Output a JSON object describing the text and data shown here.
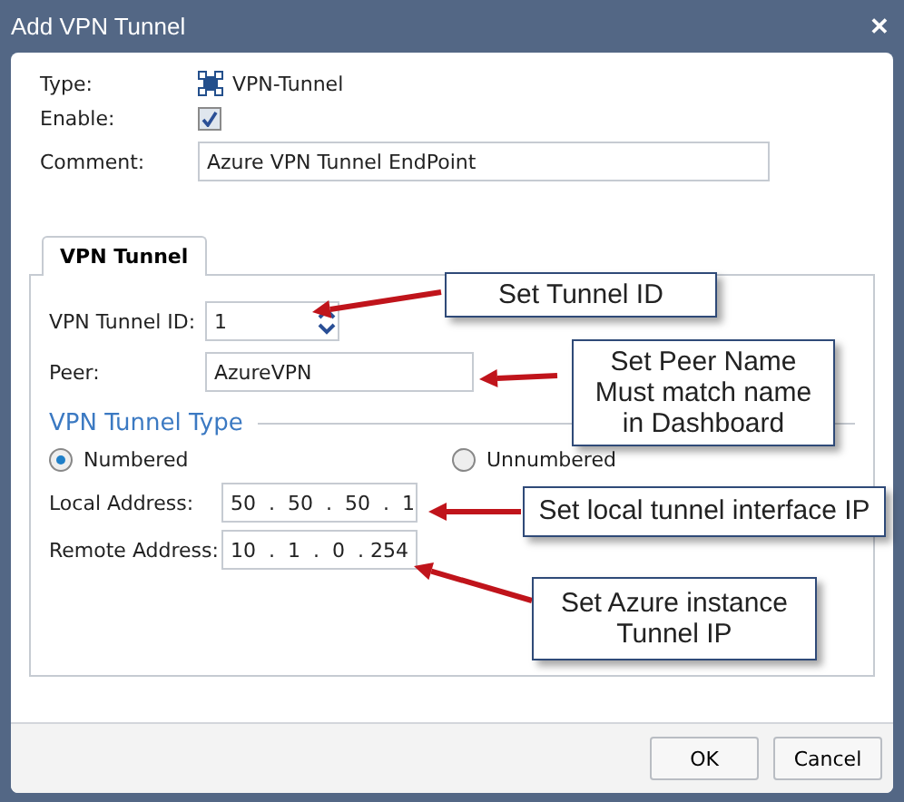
{
  "window": {
    "title": "Add VPN Tunnel",
    "close": "✕"
  },
  "general": [
    {
      "kind": "type",
      "label": "Type:",
      "value": "VPN-Tunnel"
    },
    {
      "kind": "checkbox",
      "label": "Enable:",
      "checked": true
    },
    {
      "kind": "text",
      "label": "Comment:",
      "value": "Azure VPN Tunnel EndPoint"
    }
  ],
  "tabs": [
    {
      "label": "VPN Tunnel",
      "selected": true
    }
  ],
  "tunnel": {
    "fields": [
      {
        "kind": "spinner",
        "label": "VPN Tunnel ID:",
        "value": "1"
      },
      {
        "kind": "text",
        "label": "Peer:",
        "value": "AzureVPN"
      }
    ],
    "section_title": "VPN Tunnel Type",
    "radios": [
      {
        "label": "Numbered",
        "selected": true
      },
      {
        "label": "Unnumbered",
        "selected": false
      }
    ],
    "addresses": [
      {
        "label": "Local Address:",
        "value": "50  .  50  .  50  .  1"
      },
      {
        "label": "Remote Address:",
        "value": "10  .  1  .  0  . 254"
      }
    ]
  },
  "callouts": [
    "Set Tunnel ID",
    "Set Peer Name\nMust match name\nin Dashboard",
    "Set local tunnel interface IP",
    "Set Azure instance\nTunnel IP"
  ],
  "buttons": [
    "OK",
    "Cancel"
  ]
}
